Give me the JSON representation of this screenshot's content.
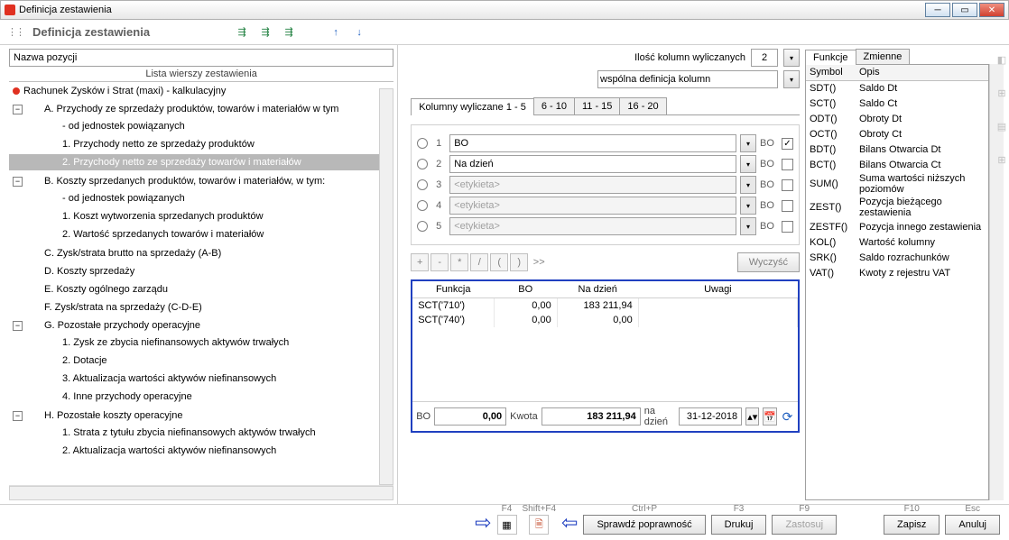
{
  "window": {
    "title": "Definicja zestawienia"
  },
  "toolbar": {
    "title": "Definicja zestawienia"
  },
  "left": {
    "nazwa_placeholder": "Nazwa pozycji",
    "list_header": "Lista wierszy zestawienia",
    "root": "Rachunek Zysków i Strat (maxi) - kalkulacyjny",
    "A": "A. Przychody ze sprzedaży produktów, towarów i materiałów w tym",
    "A_items": [
      "- od jednostek powiązanych",
      "1. Przychody netto ze sprzedaży produktów",
      "2. Przychody netto ze sprzedaży towarów i materiałów"
    ],
    "B": "B. Koszty sprzedanych produktów, towarów i materiałów, w tym:",
    "B_items": [
      "- od jednostek powiązanych",
      "1. Koszt wytworzenia sprzedanych produktów",
      "2. Wartość sprzedanych towarów i materiałów"
    ],
    "C": "C. Zysk/strata brutto na sprzedaży (A-B)",
    "D": "D. Koszty sprzedaży",
    "E": "E. Koszty ogólnego zarządu",
    "F": "F. Zysk/strata na sprzedaży (C-D-E)",
    "G": "G. Pozostałe przychody operacyjne",
    "G_items": [
      "1. Zysk ze zbycia niefinansowych aktywów trwałych",
      "2. Dotacje",
      "3. Aktualizacja wartości aktywów niefinansowych",
      "4. Inne przychody operacyjne"
    ],
    "H": "H. Pozostałe koszty operacyjne",
    "H_items": [
      "1. Strata z tytułu zbycia niefinansowych aktywów trwałych",
      "2. Aktualizacja wartości aktywów niefinansowych"
    ]
  },
  "mid": {
    "ilosc_label": "Ilość kolumn wyliczanych",
    "ilosc_value": "2",
    "wspolna": "wspólna definicja kolumn",
    "coltab_label": "Kolumny wyliczane 1 - 5",
    "coltabs": [
      "6 - 10",
      "11 - 15",
      "16 - 20"
    ],
    "cols": [
      {
        "n": "1",
        "label": "BO",
        "bo": "BO",
        "checked": true,
        "enabled": true
      },
      {
        "n": "2",
        "label": "Na dzień",
        "bo": "BO",
        "checked": false,
        "enabled": true
      },
      {
        "n": "3",
        "label": "<etykieta>",
        "bo": "BO",
        "checked": false,
        "enabled": false
      },
      {
        "n": "4",
        "label": "<etykieta>",
        "bo": "BO",
        "checked": false,
        "enabled": false
      },
      {
        "n": "5",
        "label": "<etykieta>",
        "bo": "BO",
        "checked": false,
        "enabled": false
      }
    ],
    "ops": [
      "+",
      "-",
      "*",
      "/",
      "(",
      ")",
      ">>"
    ],
    "clear": "Wyczyść",
    "grid_headers": [
      "Funkcja",
      "BO",
      "Na dzień",
      "Uwagi"
    ],
    "grid_rows": [
      {
        "f": "SCT('710')",
        "bo": "0,00",
        "nd": "183 211,94",
        "u": ""
      },
      {
        "f": "SCT('740')",
        "bo": "0,00",
        "nd": "0,00",
        "u": ""
      }
    ],
    "sum": {
      "bo_label": "BO",
      "bo_value": "0,00",
      "kwota_label": "Kwota",
      "kwota_value": "183 211,94",
      "nadz_label": "na dzień",
      "date": "31-12-2018"
    }
  },
  "funcs": {
    "tab1": "Funkcje",
    "tab2": "Zmienne",
    "h1": "Symbol",
    "h2": "Opis",
    "rows": [
      {
        "s": "SDT()",
        "o": "Saldo Dt"
      },
      {
        "s": "SCT()",
        "o": "Saldo Ct"
      },
      {
        "s": "ODT()",
        "o": "Obroty Dt"
      },
      {
        "s": "OCT()",
        "o": "Obroty Ct"
      },
      {
        "s": "BDT()",
        "o": "Bilans Otwarcia Dt"
      },
      {
        "s": "BCT()",
        "o": "Bilans Otwarcia Ct"
      },
      {
        "s": "SUM()",
        "o": "Suma wartości niższych poziomów"
      },
      {
        "s": "ZEST()",
        "o": "Pozycja bieżącego zestawienia"
      },
      {
        "s": "ZESTF()",
        "o": "Pozycja innego zestawienia"
      },
      {
        "s": "KOL()",
        "o": "Wartość kolumny"
      },
      {
        "s": "SRK()",
        "o": "Saldo rozrachunków"
      },
      {
        "s": "VAT()",
        "o": "Kwoty z rejestru VAT"
      }
    ]
  },
  "footer": {
    "f4": "F4",
    "shf4": "Shift+F4",
    "ctrlp": "Ctrl+P",
    "sprawdz": "Sprawdź poprawność",
    "f3": "F3",
    "drukuj": "Drukuj",
    "f9": "F9",
    "zastosuj": "Zastosuj",
    "f10": "F10",
    "zapisz": "Zapisz",
    "esc": "Esc",
    "anuluj": "Anuluj"
  }
}
